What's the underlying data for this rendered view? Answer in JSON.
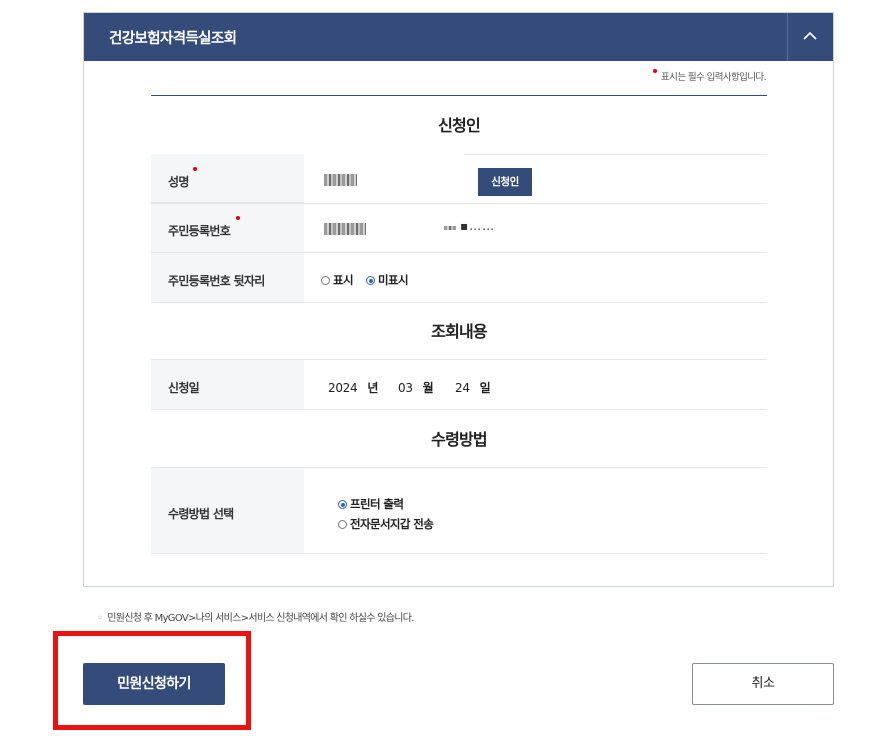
{
  "panel": {
    "title": "건강보험자격득실조회",
    "collapse_icon": "chevron-up-icon"
  },
  "required_note": "표시는 필수 입력사항입니다.",
  "sections": {
    "applicant_title": "신청인",
    "inquiry_title": "조회내용",
    "receipt_title": "수령방법"
  },
  "applicant": {
    "name_label": "성명",
    "name_value": "■ ■■",
    "applicant_button": "신청인",
    "rrn_label": "주민등록번호",
    "rrn_front": "▮■■■",
    "rrn_back": "▬ ▪……",
    "rrn_tail_label": "주민등록번호 뒷자리",
    "rrn_tail_options": [
      "표시",
      "미표시"
    ],
    "rrn_tail_selected": "미표시"
  },
  "inquiry": {
    "date_label": "신청일",
    "year": "2024",
    "year_unit": "년",
    "month": "03",
    "month_unit": "월",
    "day": "24",
    "day_unit": "일"
  },
  "receipt": {
    "method_label": "수령방법 선택",
    "options": [
      "프린터 출력",
      "전자문서지갑 전송"
    ],
    "selected": "프린터 출력"
  },
  "footnote": "민원신청 후 MyGOV>나의 서비스>서비스 신청내역에서 확인 하실수 있습니다.",
  "footnote_bullet": "◦",
  "buttons": {
    "apply": "민원신청하기",
    "cancel": "취소"
  },
  "colors": {
    "primary": "#354c7a",
    "required": "#e60012",
    "highlight": "#ee1111",
    "radio_selected": "#2f62c4"
  }
}
